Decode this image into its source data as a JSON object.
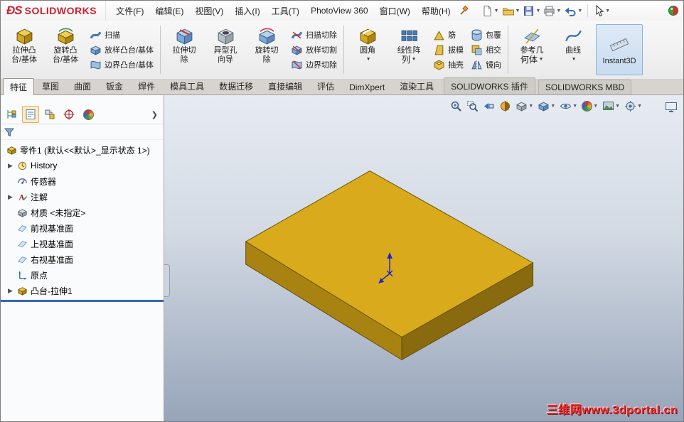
{
  "menubar": {
    "logo_prefix": "ÐS",
    "logo_brand": "SOLIDWORKS",
    "menus": [
      "文件(F)",
      "编辑(E)",
      "视图(V)",
      "插入(I)",
      "工具(T)",
      "PhotoView 360",
      "窗口(W)",
      "帮助(H)"
    ],
    "quickbar_icons": [
      "new-document",
      "open-folder",
      "save",
      "print",
      "undo",
      "select-cursor",
      "resources-sphere"
    ]
  },
  "ribbon": {
    "g1_large": [
      {
        "l1": "拉伸凸",
        "l2": "台/基体"
      },
      {
        "l1": "旋转凸",
        "l2": "台/基体"
      }
    ],
    "g1_small": [
      "扫描",
      "放样凸台/基体",
      "边界凸台/基体"
    ],
    "g2_large": [
      {
        "l1": "拉伸切",
        "l2": "除"
      },
      {
        "l1": "异型孔",
        "l2": "向导"
      },
      {
        "l1": "旋转切",
        "l2": "除"
      }
    ],
    "g2_small": [
      "扫描切除",
      "放样切割",
      "边界切除"
    ],
    "g3_large": [
      {
        "l1": "圆角",
        "l2": ""
      },
      {
        "l1": "线性阵",
        "l2": "列"
      }
    ],
    "g3_small_a": [
      "筋",
      "拔模",
      "抽壳"
    ],
    "g3_small_b": [
      "包覆",
      "相交",
      "镜向"
    ],
    "g4_large": [
      {
        "l1": "参考几",
        "l2": "何体"
      },
      {
        "l1": "曲线",
        "l2": ""
      }
    ],
    "instant3d_label": "Instant3D"
  },
  "tabs": [
    "特征",
    "草图",
    "曲面",
    "钣金",
    "焊件",
    "模具工具",
    "数据迁移",
    "直接编辑",
    "评估",
    "DimXpert",
    "渲染工具",
    "SOLIDWORKS 插件",
    "SOLIDWORKS MBD"
  ],
  "active_tab": "特征",
  "panel": {
    "tab_icons": [
      "featuremanager-tree",
      "propertymanager",
      "configurationmanager",
      "dimxpertmanager",
      "displaymanager"
    ],
    "root": "零件1 (默认<<默认>_显示状态 1>)",
    "items": [
      {
        "label": "History"
      },
      {
        "label": "传感器"
      },
      {
        "label": "注解"
      },
      {
        "label": "材质 <未指定>"
      },
      {
        "label": "前视基准面"
      },
      {
        "label": "上视基准面"
      },
      {
        "label": "右视基准面"
      },
      {
        "label": "原点"
      },
      {
        "label": "凸台-拉伸1"
      }
    ]
  },
  "viewport": {
    "headsup_icons": [
      "zoom-fit",
      "zoom-area",
      "previous-view",
      "section-view",
      "view-orientation",
      "display-style",
      "hide-show-items",
      "edit-appearance",
      "apply-scene",
      "view-settings",
      "fullscreen"
    ],
    "watermark": "三维网www.3dportal.cn"
  },
  "colors": {
    "accent_red": "#cf202f",
    "box_top": "#d9ab1c",
    "box_left": "#a98312",
    "box_right": "#8a6a0e",
    "rollback_blue": "#2f6fd0",
    "viewport_top": "#e7ebf2",
    "viewport_bottom": "#97a4b9"
  }
}
